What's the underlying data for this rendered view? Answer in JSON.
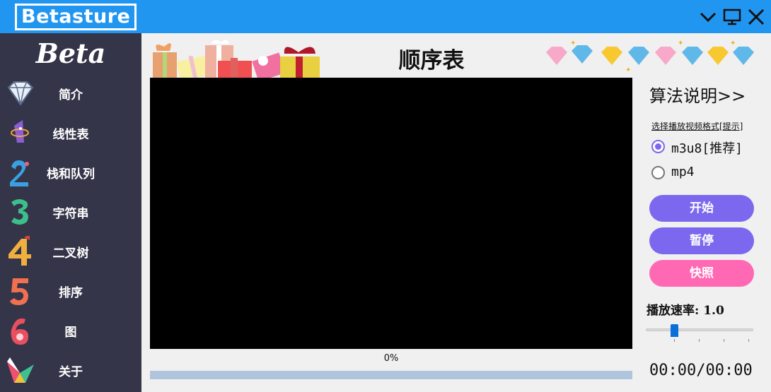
{
  "titlebar": {
    "app_name": "Betasture",
    "bg_color": "#2196f0",
    "controls": [
      "chevron-down-icon",
      "monitor-icon",
      "close-icon"
    ]
  },
  "sidebar": {
    "logo": "Beta",
    "bg_color": "#35354a",
    "items": [
      {
        "label": "简介",
        "icon": "diamond-icon"
      },
      {
        "label": "线性表",
        "icon": "number-one-icon"
      },
      {
        "label": "栈和队列",
        "icon": "number-two-icon"
      },
      {
        "label": "字符串",
        "icon": "number-three-icon"
      },
      {
        "label": "二叉树",
        "icon": "number-four-icon"
      },
      {
        "label": "排序",
        "icon": "number-five-icon"
      },
      {
        "label": "图",
        "icon": "number-six-icon"
      },
      {
        "label": "关于",
        "icon": "paper-crane-icon"
      }
    ]
  },
  "main": {
    "title": "顺序表",
    "progress_text": "0%",
    "progress_value": 0
  },
  "panel": {
    "algo_link": "算法说明>>",
    "format_label": "选择播放视频格式[提示]",
    "formats": [
      {
        "label": "m3u8[推荐]",
        "checked": true
      },
      {
        "label": "mp4",
        "checked": false
      }
    ],
    "buttons": {
      "start": "开始",
      "pause": "暂停",
      "snapshot": "快照"
    },
    "button_colors": {
      "start": "#7b68ee",
      "pause": "#7b68ee",
      "snapshot": "#ff69b4"
    },
    "speed_label": "播放速率: 1.0",
    "speed_value": 1.0,
    "time": "00:00/00:00"
  }
}
